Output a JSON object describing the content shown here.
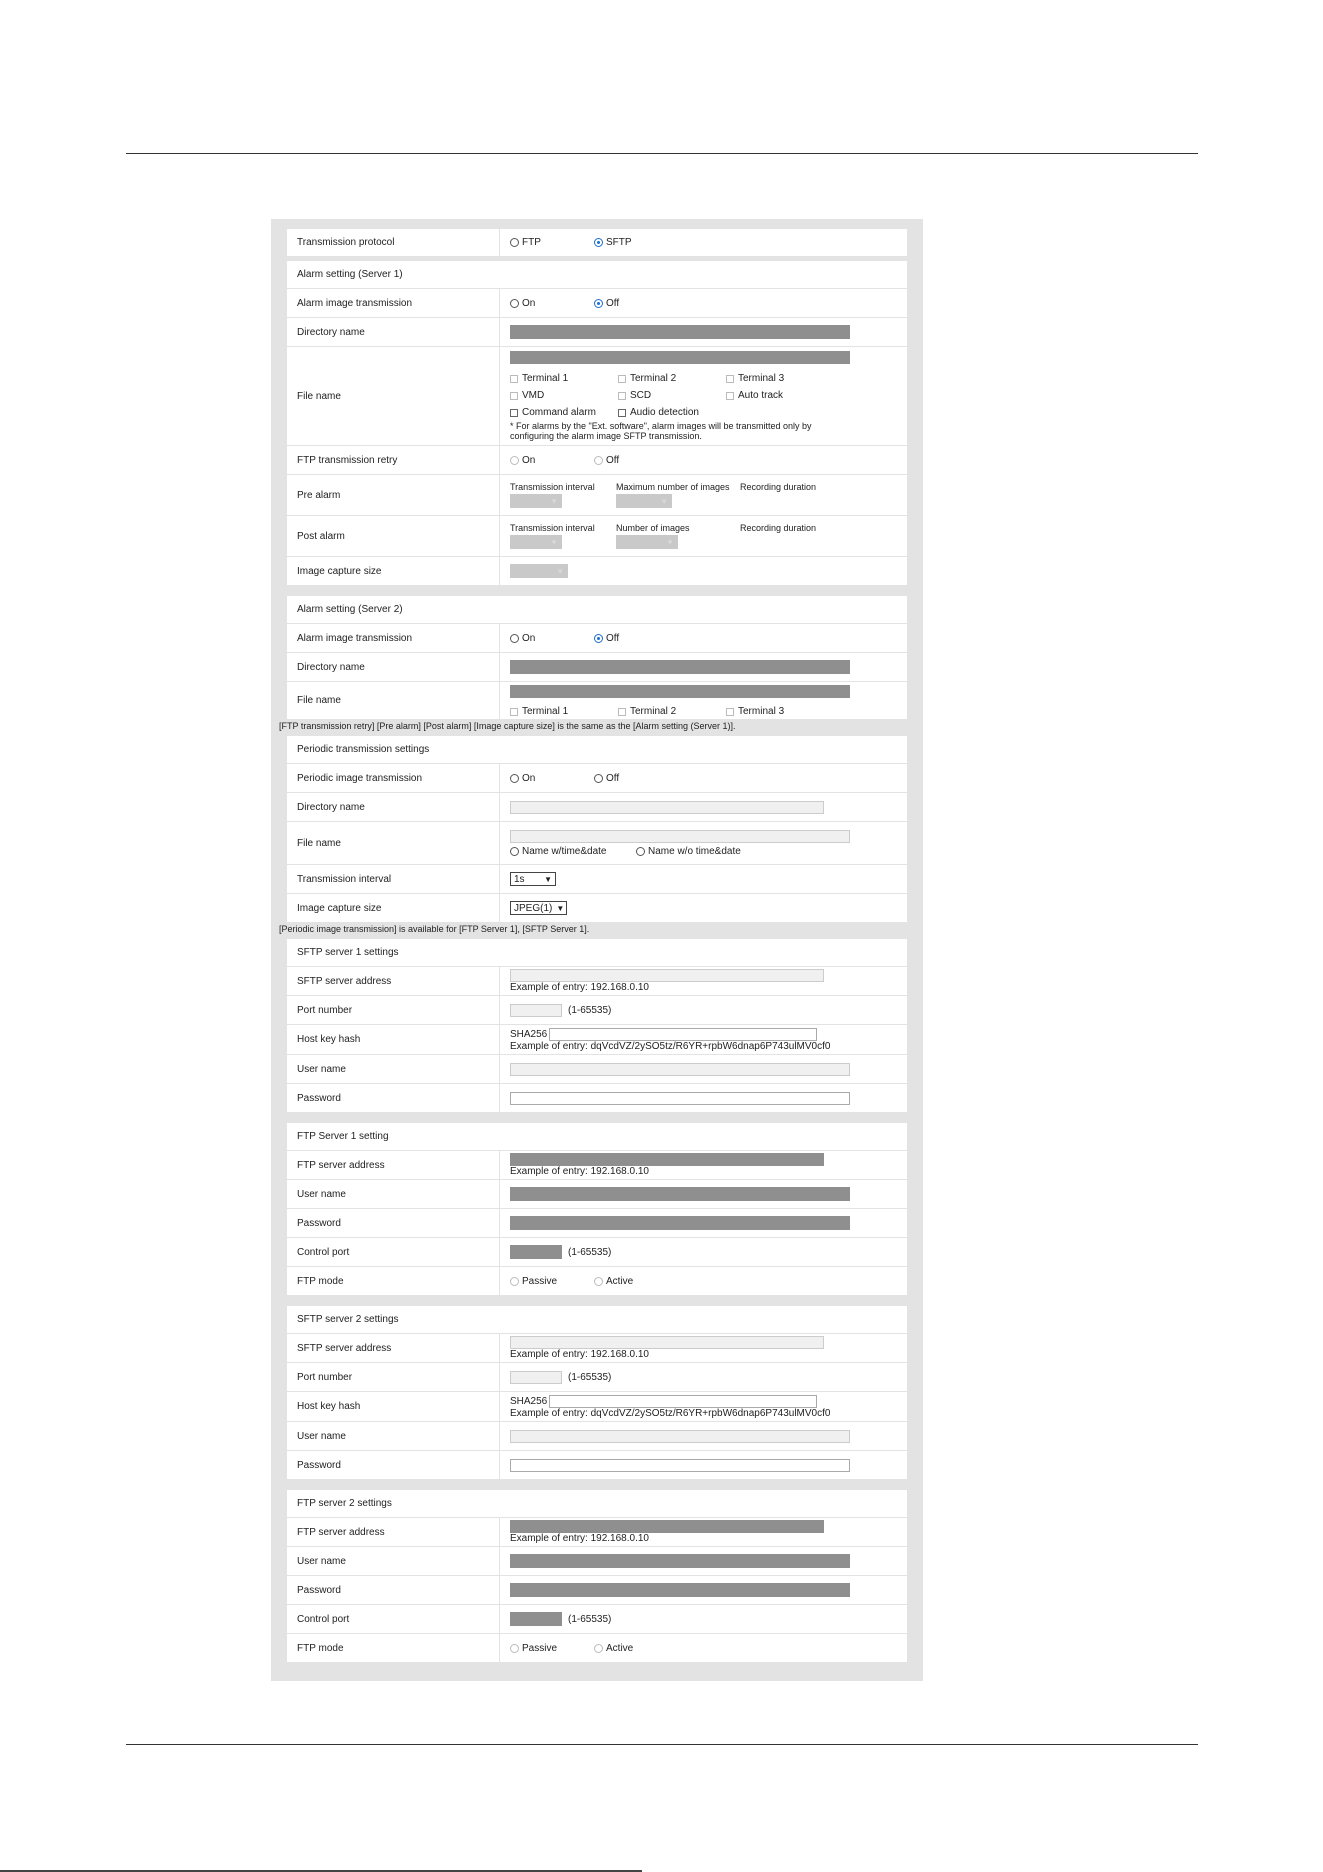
{
  "transmission": {
    "label": "Transmission protocol",
    "options": [
      "FTP",
      "SFTP"
    ],
    "selected": "SFTP"
  },
  "alarm1": {
    "header": "Alarm setting (Server 1)",
    "image_transmission": {
      "label": "Alarm image transmission",
      "on": "On",
      "off": "Off",
      "selected": "Off"
    },
    "directory_label": "Directory name",
    "file_name_label": "File name",
    "checks": [
      "Terminal 1",
      "Terminal 2",
      "Terminal 3",
      "VMD",
      "SCD",
      "Auto track",
      "Command alarm",
      "Audio detection"
    ],
    "note_line1": "* For alarms by the \"Ext. software\", alarm images will be transmitted only by",
    "note_line2": "configuring the alarm image SFTP transmission.",
    "retry": {
      "label": "FTP transmission retry",
      "on": "On",
      "off": "Off"
    },
    "pre_alarm": {
      "label": "Pre alarm",
      "col1": "Transmission interval",
      "col2": "Maximum number of images",
      "col3": "Recording duration"
    },
    "post_alarm": {
      "label": "Post alarm",
      "col1": "Transmission interval",
      "col2": "Number of images",
      "col3": "Recording duration"
    },
    "capture_label": "Image capture size"
  },
  "alarm2": {
    "header": "Alarm setting (Server 2)",
    "image_transmission": {
      "label": "Alarm image transmission",
      "on": "On",
      "off": "Off",
      "selected": "Off"
    },
    "directory_label": "Directory name",
    "file_name_label": "File name",
    "checks": [
      "Terminal 1",
      "Terminal 2",
      "Terminal 3"
    ]
  },
  "alarm2_note": "[FTP transmission retry] [Pre alarm] [Post alarm] [Image capture size] is the same as the [Alarm setting (Server 1)].",
  "periodic": {
    "header": "Periodic transmission settings",
    "image_transmission": {
      "label": "Periodic image transmission",
      "on": "On",
      "off": "Off"
    },
    "directory_label": "Directory name",
    "file_name_label": "File name",
    "name_with": "Name w/time&date",
    "name_without": "Name w/o time&date",
    "interval": {
      "label": "Transmission interval",
      "value": "1s"
    },
    "capture": {
      "label": "Image capture size",
      "value": "JPEG(1)"
    }
  },
  "periodic_note": "[Periodic image transmission] is available for [FTP Server 1], [SFTP Server 1].",
  "sftp1": {
    "header": "SFTP server 1 settings",
    "address_label": "SFTP server address",
    "example": "Example of entry: 192.168.0.10",
    "port_label": "Port number",
    "port_range": "(1-65535)",
    "hash_label": "Host key hash",
    "hash_prefix": "SHA256",
    "hash_example": "Example of entry: dqVcdVZ/2ySO5tz/R6YR+rpbW6dnap6P743ulMV0cf0",
    "user_label": "User name",
    "password_label": "Password"
  },
  "ftp1": {
    "header": "FTP Server 1 setting",
    "address_label": "FTP server address",
    "example": "Example of entry: 192.168.0.10",
    "user_label": "User name",
    "password_label": "Password",
    "port_label": "Control port",
    "port_range": "(1-65535)",
    "mode_label": "FTP mode",
    "passive": "Passive",
    "active": "Active"
  },
  "sftp2": {
    "header": "SFTP server 2 settings",
    "address_label": "SFTP server address",
    "example": "Example of entry: 192.168.0.10",
    "port_label": "Port number",
    "port_range": "(1-65535)",
    "hash_label": "Host key hash",
    "hash_prefix": "SHA256",
    "hash_example": "Example of entry: dqVcdVZ/2ySO5tz/R6YR+rpbW6dnap6P743ulMV0cf0",
    "user_label": "User name",
    "password_label": "Password"
  },
  "ftp2": {
    "header": "FTP server 2 settings",
    "address_label": "FTP server address",
    "example": "Example of entry: 192.168.0.10",
    "user_label": "User name",
    "password_label": "Password",
    "port_label": "Control port",
    "port_range": "(1-65535)",
    "mode_label": "FTP mode",
    "passive": "Passive",
    "active": "Active"
  },
  "colors": {
    "panel": "#e3e3e3",
    "disabled_bar": "#8f8f8f",
    "radio_selected": "#1a6fd0"
  }
}
